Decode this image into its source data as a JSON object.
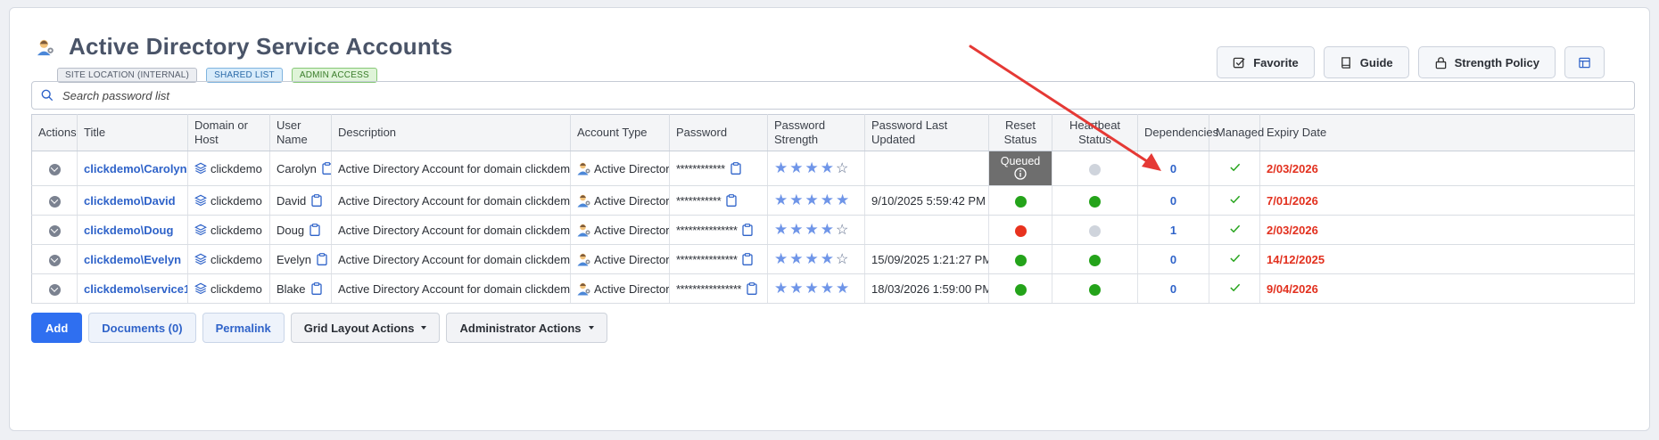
{
  "page": {
    "title": "Active Directory Service Accounts",
    "badges": [
      "SITE LOCATION (INTERNAL)",
      "SHARED LIST",
      "ADMIN ACCESS"
    ]
  },
  "toolbar": {
    "favorite": "Favorite",
    "guide": "Guide",
    "strength_policy": "Strength Policy"
  },
  "search": {
    "placeholder": "Search password list",
    "value": ""
  },
  "grid": {
    "columns": [
      "Actions",
      "Title",
      "Domain or Host",
      "User Name",
      "Description",
      "Account Type",
      "Password",
      "Password Strength",
      "Password Last Updated",
      "Reset Status",
      "Heartbeat Status",
      "Dependencies",
      "Managed",
      "Expiry Date"
    ],
    "rows": [
      {
        "title": "clickdemo\\Carolyn",
        "domain": "clickdemo",
        "user": "Carolyn",
        "description": "Active Directory Account for domain clickdemo.com",
        "account_type": "Active Directory",
        "password": "************",
        "strength": 4,
        "last_updated": "",
        "reset_status": "Queued",
        "heartbeat": "gray",
        "dependencies": "0",
        "expiry": "2/03/2026"
      },
      {
        "title": "clickdemo\\David",
        "domain": "clickdemo",
        "user": "David",
        "description": "Active Directory Account for domain clickdemo.com",
        "account_type": "Active Directory",
        "password": "***********",
        "strength": 5,
        "last_updated": "9/10/2025 5:59:42 PM",
        "reset_status": "green",
        "heartbeat": "green",
        "dependencies": "0",
        "expiry": "7/01/2026"
      },
      {
        "title": "clickdemo\\Doug",
        "domain": "clickdemo",
        "user": "Doug",
        "description": "Active Directory Account for domain clickdemo.com",
        "account_type": "Active Directory",
        "password": "***************",
        "strength": 4,
        "last_updated": "",
        "reset_status": "red",
        "heartbeat": "gray",
        "dependencies": "1",
        "expiry": "2/03/2026"
      },
      {
        "title": "clickdemo\\Evelyn",
        "domain": "clickdemo",
        "user": "Evelyn",
        "description": "Active Directory Account for domain clickdemo.com",
        "account_type": "Active Directory",
        "password": "***************",
        "strength": 4,
        "last_updated": "15/09/2025 1:21:27 PM",
        "reset_status": "green",
        "heartbeat": "green",
        "dependencies": "0",
        "expiry": "14/12/2025"
      },
      {
        "title": "clickdemo\\service1",
        "domain": "clickdemo",
        "user": "Blake",
        "description": "Active Directory Account for domain clickdemo.com",
        "account_type": "Active Directory",
        "password": "****************",
        "strength": 5,
        "last_updated": "18/03/2026 1:59:00 PM",
        "reset_status": "green",
        "heartbeat": "green",
        "dependencies": "0",
        "expiry": "9/04/2026"
      }
    ]
  },
  "bottom": {
    "add": "Add",
    "documents": "Documents (0)",
    "permalink": "Permalink",
    "grid_layout": "Grid Layout Actions",
    "admin": "Administrator Actions"
  },
  "colors": {
    "accent": "#2f6ff0",
    "link": "#2f63c9",
    "expiry": "#e2301e",
    "status_green": "#24a31a",
    "status_red": "#e8321e",
    "status_gray": "#cfd4dc",
    "annotation_arrow": "#e53935"
  }
}
